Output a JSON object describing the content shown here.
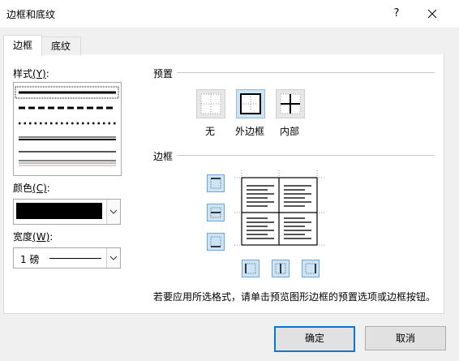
{
  "dialog": {
    "title": "边框和底纹",
    "help": "?",
    "close": "×"
  },
  "tabs": [
    {
      "label": "边框"
    },
    {
      "label": "底纹"
    }
  ],
  "left": {
    "style_label": "样式",
    "style_key": "(Y)",
    "style_colon": ":",
    "color_label": "颜色",
    "color_key": "(C)",
    "color_colon": ":",
    "color_value": "#000000",
    "width_label": "宽度",
    "width_key": "(W)",
    "width_colon": ":",
    "width_value": "1 磅"
  },
  "presets": {
    "section_label": "预置",
    "items": [
      {
        "label": "无"
      },
      {
        "label": "外边框"
      },
      {
        "label": "内部"
      }
    ]
  },
  "border": {
    "section_label": "边框",
    "hint": "若要应用所选格式，请单击预览图形边框的预置选项或边框按钮。"
  },
  "buttons": {
    "ok": "确定",
    "cancel": "取消"
  }
}
